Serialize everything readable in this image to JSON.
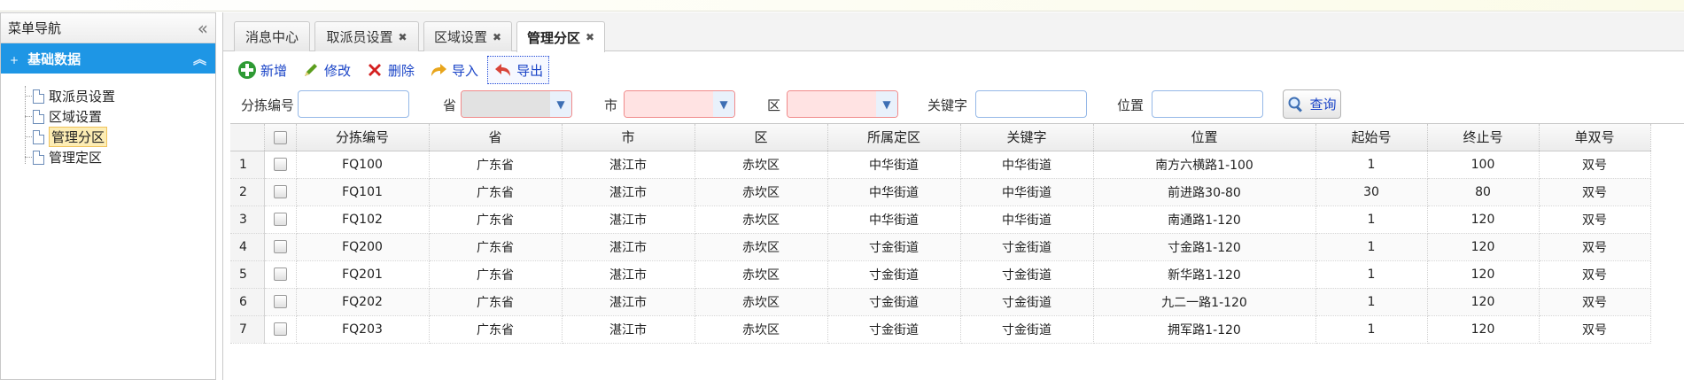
{
  "sidebar": {
    "title": "菜单导航",
    "section_title": "基础数据",
    "items": [
      {
        "label": "取派员设置"
      },
      {
        "label": "区域设置"
      },
      {
        "label": "管理分区",
        "selected": true
      },
      {
        "label": "管理定区"
      }
    ]
  },
  "tabs": [
    {
      "label": "消息中心",
      "closable": false
    },
    {
      "label": "取派员设置",
      "closable": true
    },
    {
      "label": "区域设置",
      "closable": true
    },
    {
      "label": "管理分区",
      "closable": true,
      "active": true
    }
  ],
  "toolbar": {
    "add": "新增",
    "edit": "修改",
    "delete": "删除",
    "import": "导入",
    "export": "导出"
  },
  "filters": {
    "code_label": "分拣编号",
    "province_label": "省",
    "city_label": "市",
    "district_label": "区",
    "keyword_label": "关键字",
    "address_label": "位置",
    "query": "查询"
  },
  "table": {
    "headers": [
      "分拣编号",
      "省",
      "市",
      "区",
      "所属定区",
      "关键字",
      "位置",
      "起始号",
      "终止号",
      "单双号"
    ],
    "rows": [
      {
        "n": "1",
        "cells": [
          "FQ100",
          "广东省",
          "湛江市",
          "赤坎区",
          "中华街道",
          "中华街道",
          "南方六横路1-100",
          "1",
          "100",
          "双号"
        ]
      },
      {
        "n": "2",
        "cells": [
          "FQ101",
          "广东省",
          "湛江市",
          "赤坎区",
          "中华街道",
          "中华街道",
          "前进路30-80",
          "30",
          "80",
          "双号"
        ]
      },
      {
        "n": "3",
        "cells": [
          "FQ102",
          "广东省",
          "湛江市",
          "赤坎区",
          "中华街道",
          "中华街道",
          "南通路1-120",
          "1",
          "120",
          "双号"
        ]
      },
      {
        "n": "4",
        "cells": [
          "FQ200",
          "广东省",
          "湛江市",
          "赤坎区",
          "寸金街道",
          "寸金街道",
          "寸金路1-120",
          "1",
          "120",
          "双号"
        ]
      },
      {
        "n": "5",
        "cells": [
          "FQ201",
          "广东省",
          "湛江市",
          "赤坎区",
          "寸金街道",
          "寸金街道",
          "新华路1-120",
          "1",
          "120",
          "双号"
        ]
      },
      {
        "n": "6",
        "cells": [
          "FQ202",
          "广东省",
          "湛江市",
          "赤坎区",
          "寸金街道",
          "寸金街道",
          "九二一路1-120",
          "1",
          "120",
          "双号"
        ]
      },
      {
        "n": "7",
        "cells": [
          "FQ203",
          "广东省",
          "湛江市",
          "赤坎区",
          "寸金街道",
          "寸金街道",
          "拥军路1-120",
          "1",
          "120",
          "双号"
        ]
      }
    ]
  },
  "colors": {
    "accent": "#1e96e5",
    "link": "#1a44c7"
  }
}
